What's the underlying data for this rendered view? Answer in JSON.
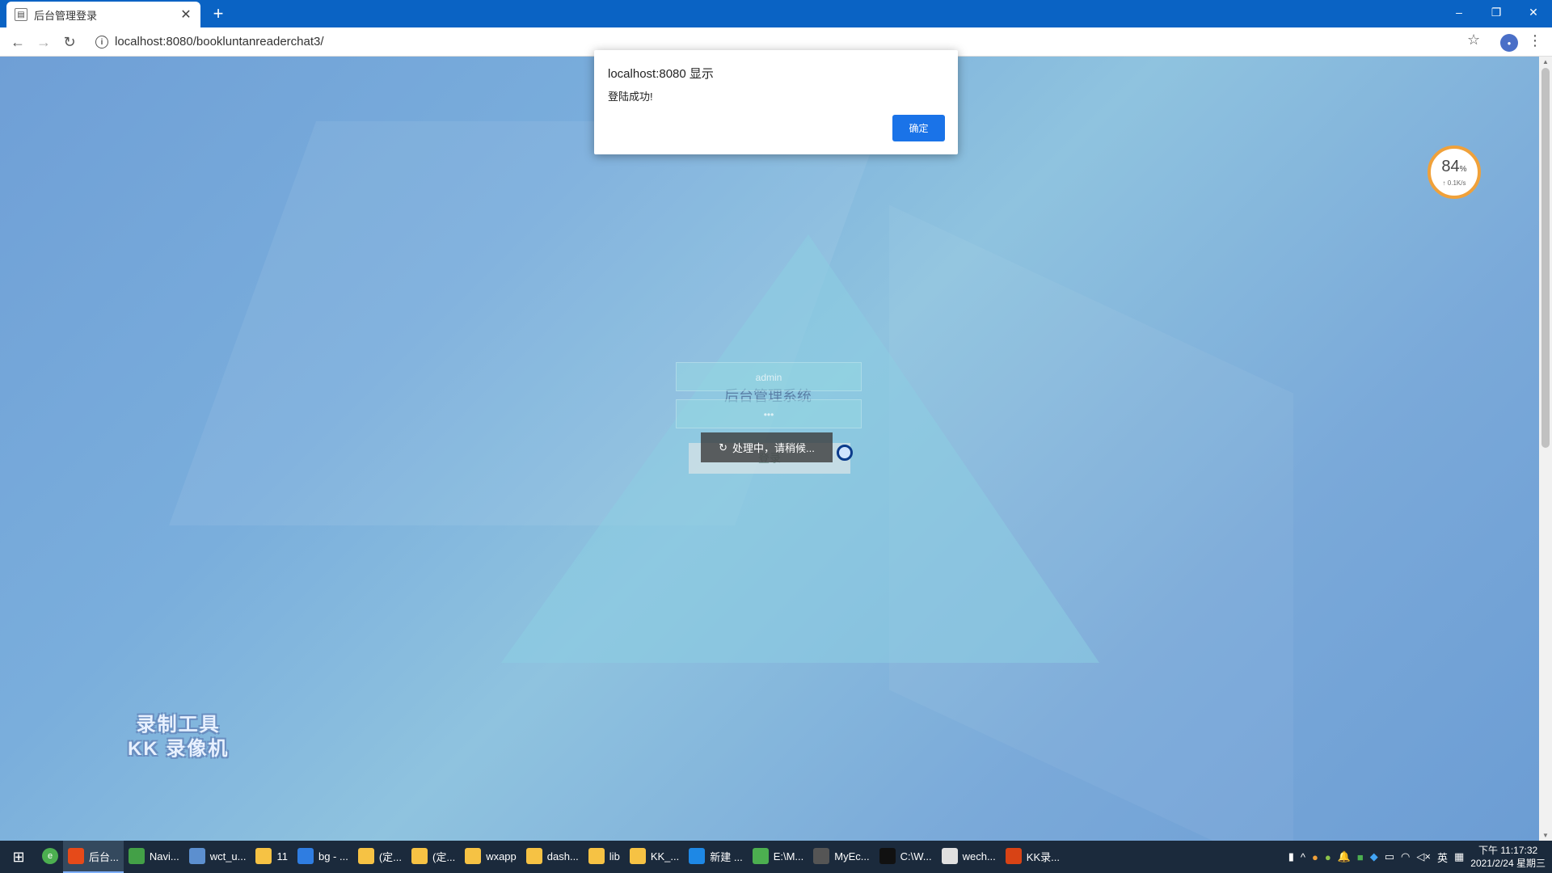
{
  "browser": {
    "tab_title": "后台管理登录",
    "tab_close": "✕",
    "new_tab": "+",
    "url": "localhost:8080/bookluntanreaderchat3/",
    "window_controls": [
      "–",
      "❐",
      "✕"
    ]
  },
  "dialog": {
    "title": "localhost:8080 显示",
    "message": "登陆成功!",
    "ok_label": "确定"
  },
  "login": {
    "title": "后台管理系统",
    "username_value": "admin",
    "password_value": "•••",
    "button_label": "登录",
    "loading_text": "处理中，请稍候..."
  },
  "speed_widget": {
    "percent": "84",
    "percent_unit": "%",
    "rate": "↑ 0.1K/s"
  },
  "watermark": {
    "line1": "录制工具",
    "line2": "KK 录像机"
  },
  "taskbar": {
    "items": [
      {
        "label": "后台...",
        "icon": "chrome-icon",
        "color": "#e64a19",
        "active": true
      },
      {
        "label": "Navi...",
        "icon": "navicat-icon",
        "color": "#43a047",
        "active": false
      },
      {
        "label": "wct_u...",
        "icon": "app-icon",
        "color": "#5c8fcf",
        "active": false
      },
      {
        "label": "11",
        "icon": "folder-icon",
        "color": "#f6c244",
        "active": false
      },
      {
        "label": "bg - ...",
        "icon": "app-icon",
        "color": "#2f7de1",
        "active": false
      },
      {
        "label": "(定...",
        "icon": "folder-icon",
        "color": "#f6c244",
        "active": false
      },
      {
        "label": "(定...",
        "icon": "folder-icon",
        "color": "#f6c244",
        "active": false
      },
      {
        "label": "wxapp",
        "icon": "folder-icon",
        "color": "#f6c244",
        "active": false
      },
      {
        "label": "dash...",
        "icon": "folder-icon",
        "color": "#f6c244",
        "active": false
      },
      {
        "label": "lib",
        "icon": "folder-icon",
        "color": "#f6c244",
        "active": false
      },
      {
        "label": "KK_...",
        "icon": "folder-icon",
        "color": "#f6c244",
        "active": false
      },
      {
        "label": "新建 ...",
        "icon": "vscode-icon",
        "color": "#1e88e5",
        "active": false
      },
      {
        "label": "E:\\M...",
        "icon": "notepad-icon",
        "color": "#4caf50",
        "active": false
      },
      {
        "label": "MyEc...",
        "icon": "myeclipse-icon",
        "color": "#555555",
        "active": false
      },
      {
        "label": "C:\\W...",
        "icon": "cmd-icon",
        "color": "#111111",
        "active": false
      },
      {
        "label": "wech...",
        "icon": "wechat-icon",
        "color": "#e0e0e0",
        "active": false
      },
      {
        "label": "KK录...",
        "icon": "kk-icon",
        "color": "#d84315",
        "active": false
      }
    ],
    "tray_lang": "英",
    "time": "下午 11:17:32",
    "date": "2021/2/24 星期三"
  }
}
